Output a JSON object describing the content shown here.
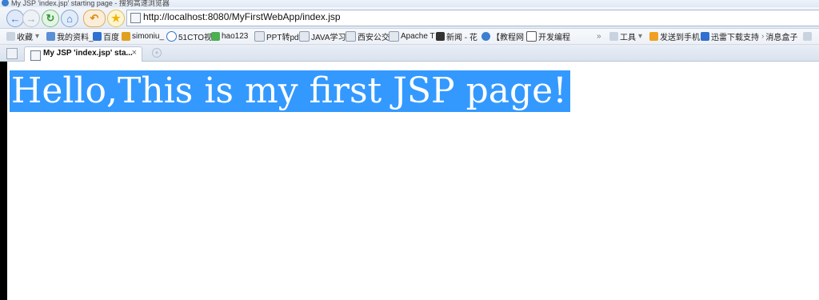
{
  "window": {
    "title": "My JSP 'index.jsp' starting page - 搜狗高速浏览器"
  },
  "toolbar": {
    "url": "http://localhost:8080/MyFirstWebApp/index.jsp"
  },
  "bookmarks": [
    {
      "label": "收藏",
      "icon": "star-icon"
    },
    {
      "label": "我的资料_",
      "icon": "folder-icon"
    },
    {
      "label": "百度",
      "icon": "baidu-icon"
    },
    {
      "label": "simoniu_",
      "icon": "bookmark-icon"
    },
    {
      "label": "51CTO视",
      "icon": "play-icon"
    },
    {
      "label": "hao123",
      "icon": "hao123-icon"
    },
    {
      "label": "PPT转pdf",
      "icon": "page-icon"
    },
    {
      "label": "JAVA学习",
      "icon": "page-icon"
    },
    {
      "label": "西安公交",
      "icon": "page-icon"
    },
    {
      "label": "Apache T",
      "icon": "page-icon"
    },
    {
      "label": "新闻 - 花",
      "icon": "news-icon"
    },
    {
      "label": "【教程网",
      "icon": "bird-icon"
    },
    {
      "label": "开发编程",
      "icon": "search-icon"
    }
  ],
  "bookmarks_right": [
    {
      "label": "工具",
      "icon": "tools-icon"
    },
    {
      "label": "发送到手机",
      "icon": "phone-icon"
    },
    {
      "label": "迅雷下载支持",
      "icon": "thunder-icon"
    },
    {
      "label": "消息盒子",
      "icon": "message-icon"
    }
  ],
  "tabs": [
    {
      "label": "My JSP 'index.jsp' sta...",
      "close": "×"
    }
  ],
  "page": {
    "heading": "Hello,This is my first JSP page!"
  },
  "colors": {
    "selection": "#3399ff",
    "back": "#2f6fd0",
    "refresh": "#2f9a3a",
    "home": "#2f6fd0",
    "undo": "#e08a12",
    "favorite": "#f0b400"
  }
}
